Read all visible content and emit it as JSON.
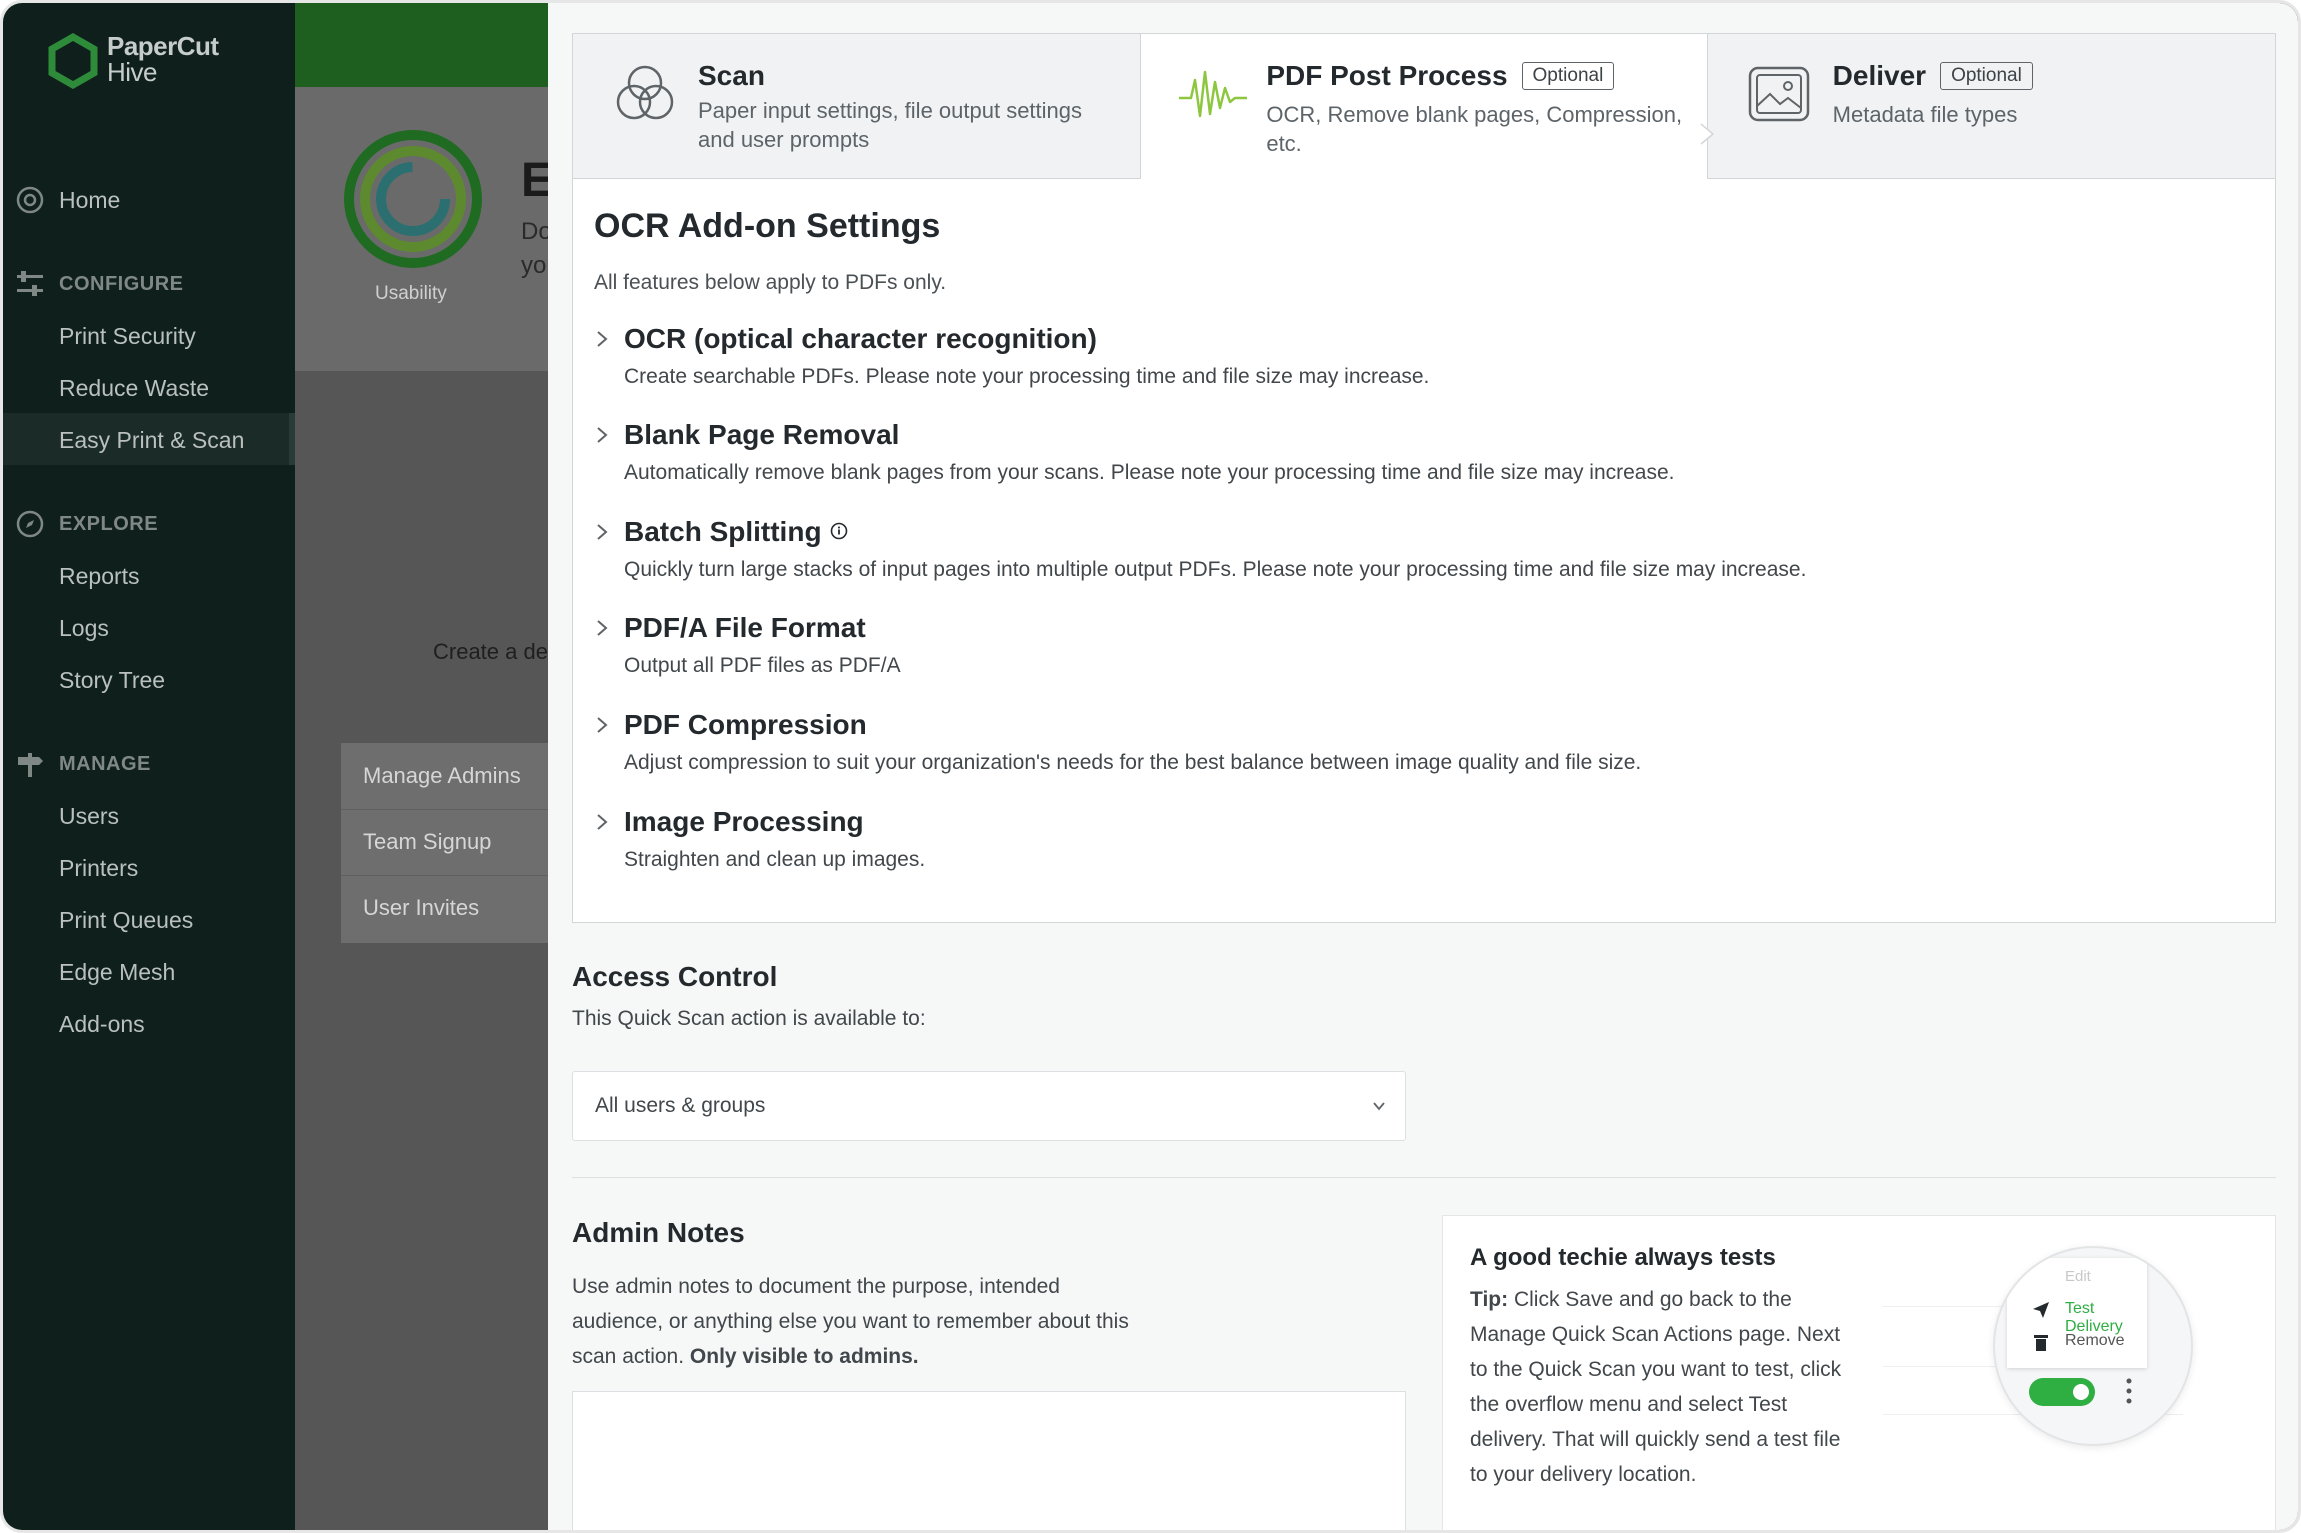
{
  "app": {
    "logo_line1": "PaperCut",
    "logo_line2": "Hive"
  },
  "sidebar": {
    "home": "Home",
    "configure_section": "CONFIGURE",
    "configure_items": [
      "Print Security",
      "Reduce Waste",
      "Easy Print & Scan"
    ],
    "explore_section": "EXPLORE",
    "explore_items": [
      "Reports",
      "Logs",
      "Story Tree"
    ],
    "manage_section": "MANAGE",
    "manage_items": [
      "Users",
      "Printers",
      "Print Queues",
      "Edge Mesh",
      "Add-ons"
    ]
  },
  "background": {
    "usability_label": "Usability",
    "heading_fragment": "E",
    "desc_fragment_1": "Do",
    "desc_fragment_2": "yo",
    "create_text": "Create a del",
    "menu_items": [
      "Manage Admins",
      "Team Signup",
      "User Invites"
    ]
  },
  "steps": [
    {
      "title": "Scan",
      "badge": "",
      "desc": "Paper input settings, file output settings and user prompts"
    },
    {
      "title": "PDF Post Process",
      "badge": "Optional",
      "desc": "OCR, Remove blank pages, Compression, etc."
    },
    {
      "title": "Deliver",
      "badge": "Optional",
      "desc": "Metadata file types"
    }
  ],
  "ocr": {
    "title": "OCR Add-on Settings",
    "subtitle": "All features below apply to PDFs only.",
    "features": [
      {
        "title": "OCR (optical character recognition)",
        "desc": "Create searchable PDFs. Please note your processing time and file size may increase."
      },
      {
        "title": "Blank Page Removal",
        "desc": "Automatically remove blank pages from your scans. Please note your processing time and file size may increase."
      },
      {
        "title": "Batch Splitting",
        "desc": "Quickly turn large stacks of input pages into multiple output PDFs. Please note your processing time and file size may increase."
      },
      {
        "title": "PDF/A File Format",
        "desc": "Output all PDF files as PDF/A"
      },
      {
        "title": "PDF Compression",
        "desc": "Adjust compression to suit your organization's needs for the best balance between image quality and file size."
      },
      {
        "title": "Image Processing",
        "desc": "Straighten and clean up images."
      }
    ]
  },
  "access": {
    "title": "Access Control",
    "text": "This Quick Scan action is available to:",
    "selected": "All users & groups"
  },
  "notes": {
    "title": "Admin Notes",
    "text": "Use admin notes to document the purpose, intended audience, or anything else you want to remember about this scan action.",
    "text_bold": "Only visible to admins."
  },
  "tip": {
    "title": "A good techie always tests",
    "tip_label": "Tip:",
    "text": "Click Save and go back to the Manage Quick Scan Actions page. Next to the Quick Scan you want to test, click the overflow menu and select Test delivery. That will quickly send a test file to your delivery location.",
    "illus_edit": "Edit",
    "illus_test": "Test Delivery",
    "illus_remove": "Remove"
  },
  "colors": {
    "accent_green": "#2fae42",
    "sidebar_bg": "#0e1f1c",
    "pdf_icon": "#8dc63f"
  }
}
